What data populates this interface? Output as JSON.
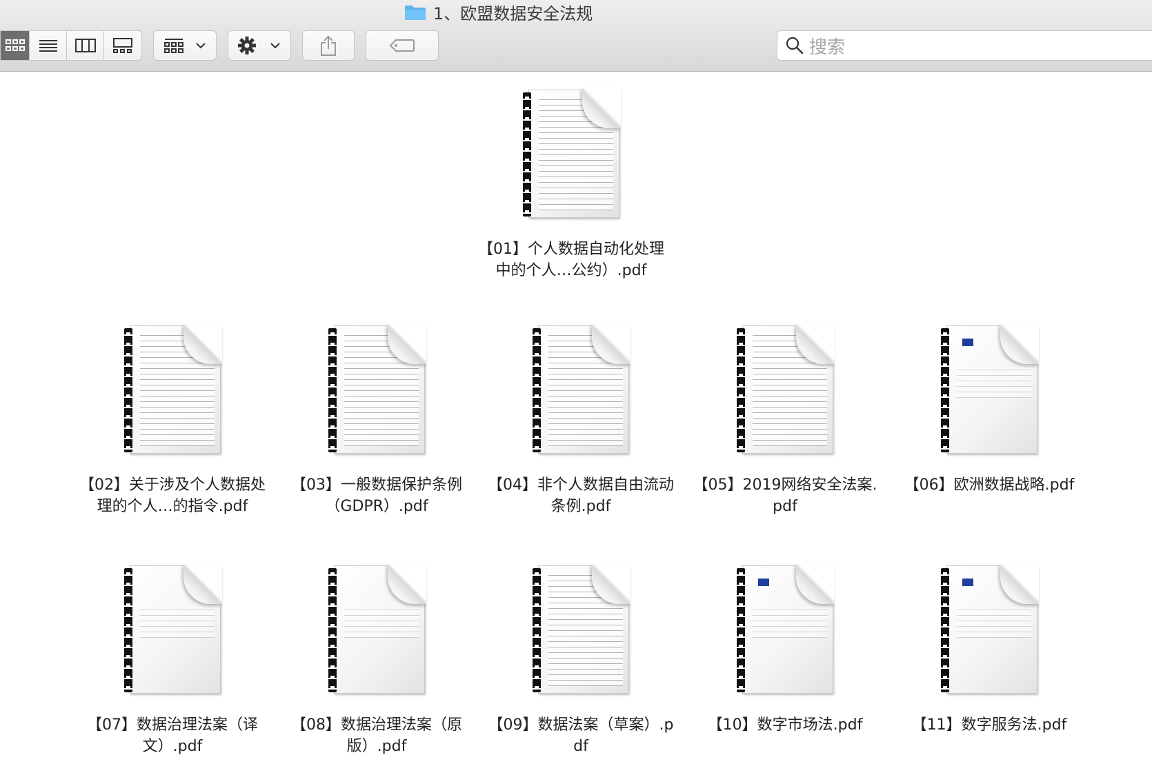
{
  "window": {
    "title": "1、欧盟数据安全法规"
  },
  "toolbar": {
    "view_icons": [
      "icon-view-icon",
      "list-view-icon",
      "column-view-icon",
      "gallery-view-icon"
    ],
    "group_icon": "group-by-icon",
    "action_icon": "gear-icon",
    "share_icon": "share-icon",
    "tag_icon": "tag-icon"
  },
  "search": {
    "placeholder": "搜索",
    "icon": "search-icon"
  },
  "files": [
    {
      "name": "【01】个人数据自动化处理中的个人…公约）.pdf"
    },
    {
      "name": "【02】关于涉及个人数据处理的个人…的指令.pdf"
    },
    {
      "name": "【03】一般数据保护条例（GDPR）.pdf"
    },
    {
      "name": "【04】非个人数据自由流动条例.pdf"
    },
    {
      "name": "【05】2019网络安全法案.pdf"
    },
    {
      "name": "【06】欧洲数据战略.pdf"
    },
    {
      "name": "【07】数据治理法案（译文）.pdf"
    },
    {
      "name": "【08】数据治理法案（原版）.pdf"
    },
    {
      "name": "【09】数据法案（草案）.pdf"
    },
    {
      "name": "【10】数字市场法.pdf"
    },
    {
      "name": "【11】数字服务法.pdf"
    }
  ]
}
